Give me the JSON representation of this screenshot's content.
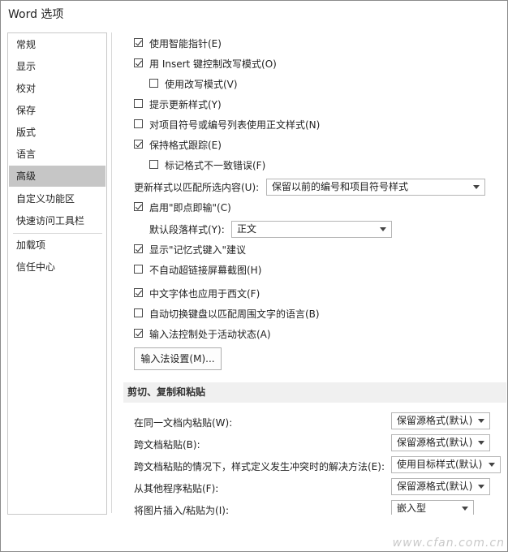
{
  "window": {
    "title": "Word 选项"
  },
  "sidebar": {
    "items": [
      {
        "label": "常规"
      },
      {
        "label": "显示"
      },
      {
        "label": "校对"
      },
      {
        "label": "保存"
      },
      {
        "label": "版式"
      },
      {
        "label": "语言"
      },
      {
        "label": "高级",
        "active": true
      },
      {
        "label": "自定义功能区"
      },
      {
        "label": "快速访问工具栏"
      },
      {
        "label": "加载项"
      },
      {
        "label": "信任中心"
      }
    ]
  },
  "options": {
    "smart_pointer": {
      "label": "使用智能指针(E)",
      "checked": true
    },
    "insert_key": {
      "label": "用 Insert 键控制改写模式(O)",
      "checked": true
    },
    "overtype": {
      "label": "使用改写模式(V)",
      "checked": false
    },
    "prompt_update_style": {
      "label": "提示更新样式(Y)",
      "checked": false
    },
    "normal_style_lists": {
      "label": "对项目符号或编号列表使用正文样式(N)",
      "checked": false
    },
    "keep_track_formatting": {
      "label": "保持格式跟踪(E)",
      "checked": true
    },
    "mark_inconsistencies": {
      "label": "标记格式不一致错误(F)",
      "checked": false
    },
    "update_style_label": "更新样式以匹配所选内容(U):",
    "update_style_value": "保留以前的编号和项目符号样式",
    "click_and_type": {
      "label": "启用\"即点即输\"(C)",
      "checked": true
    },
    "default_paragraph_label": "默认段落样式(Y):",
    "default_paragraph_value": "正文",
    "autocomplete": {
      "label": "显示\"记忆式键入\"建议",
      "checked": true
    },
    "no_hyperlink_screenshot": {
      "label": "不自动超链接屏幕截图(H)",
      "checked": false
    },
    "chinese_font_western": {
      "label": "中文字体也应用于西文(F)",
      "checked": true
    },
    "auto_switch_keyboard": {
      "label": "自动切换键盘以匹配周围文字的语言(B)",
      "checked": false
    },
    "ime_control": {
      "label": "输入法控制处于活动状态(A)",
      "checked": true
    },
    "ime_settings_button": "输入法设置(M)..."
  },
  "paste_section": {
    "header": "剪切、复制和粘贴",
    "rows": [
      {
        "label": "在同一文档内粘贴(W):",
        "value": "保留源格式(默认)"
      },
      {
        "label": "跨文档粘贴(B):",
        "value": "保留源格式(默认)"
      },
      {
        "label": "跨文档粘贴的情况下，样式定义发生冲突时的解决方法(E):",
        "value": "使用目标样式(默认)"
      },
      {
        "label": "从其他程序粘贴(F):",
        "value": "保留源格式(默认)"
      },
      {
        "label": "将图片插入/粘贴为(I):",
        "value": "嵌入型"
      }
    ]
  },
  "watermark": "www.cfan.com.cn"
}
